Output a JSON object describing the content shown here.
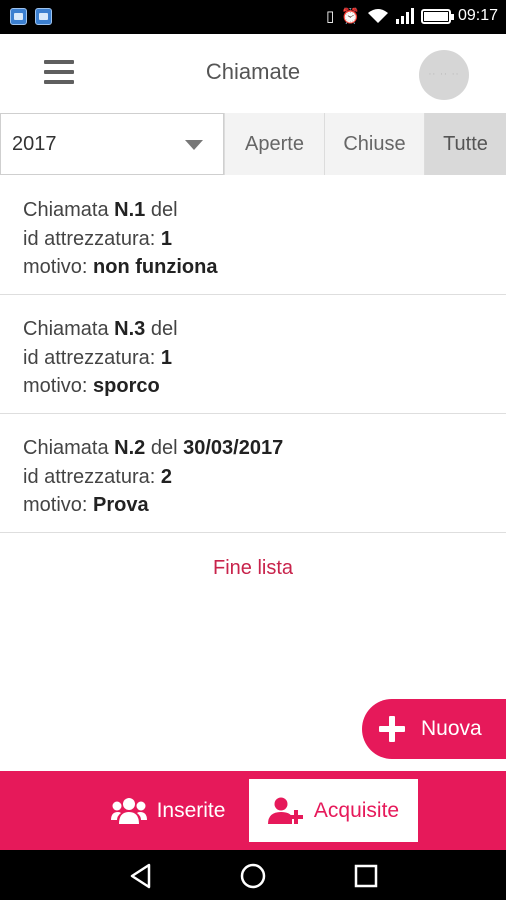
{
  "status_bar": {
    "time": "09:17",
    "icons": [
      "photo-app-icon",
      "gallery-app-icon",
      "vibrate-icon",
      "alarm-icon",
      "wifi-icon",
      "signal-icon",
      "battery-icon"
    ]
  },
  "header": {
    "title": "Chiamate",
    "menu_icon": "hamburger-menu-icon",
    "avatar_text": "·· ·· ··"
  },
  "filters": {
    "year_selected": "2017",
    "tabs": [
      {
        "label": "Aperte",
        "active": false
      },
      {
        "label": "Chiuse",
        "active": false
      },
      {
        "label": "Tutte",
        "active": true
      }
    ]
  },
  "calls": [
    {
      "prefix": "Chiamata",
      "number": "N.1",
      "del_label": "del",
      "date": "",
      "equip_label": "id attrezzatura:",
      "equip_id": "1",
      "reason_label": "motivo:",
      "reason": "non funziona"
    },
    {
      "prefix": "Chiamata",
      "number": "N.3",
      "del_label": "del",
      "date": "",
      "equip_label": "id attrezzatura:",
      "equip_id": "1",
      "reason_label": "motivo:",
      "reason": "sporco"
    },
    {
      "prefix": "Chiamata",
      "number": "N.2",
      "del_label": "del",
      "date": "30/03/2017",
      "equip_label": "id attrezzatura:",
      "equip_id": "2",
      "reason_label": "motivo:",
      "reason": "Prova"
    }
  ],
  "list_end": "Fine lista",
  "fab": {
    "label": "Nuova",
    "icon": "plus-icon"
  },
  "bottom_tabs": [
    {
      "label": "Inserite",
      "icon": "group-users-icon",
      "active": false
    },
    {
      "label": "Acquisite",
      "icon": "add-user-icon",
      "active": true
    }
  ],
  "colors": {
    "accent": "#e6195a",
    "end_text": "#c8234b",
    "active_tab": "#d9d9d9"
  }
}
